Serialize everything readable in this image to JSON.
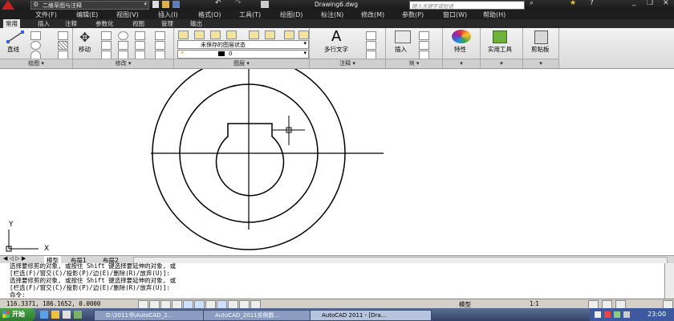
{
  "title_bar": {
    "workspace": "二维草图与注释",
    "document": "Drawing6.dwg",
    "search_placeholder": "键入关键字或短语"
  },
  "menu": [
    "文件(F)",
    "编辑(E)",
    "视图(V)",
    "插入(I)",
    "格式(O)",
    "工具(T)",
    "绘图(D)",
    "标注(N)",
    "修改(M)",
    "参数(P)",
    "窗口(W)",
    "帮助(H)"
  ],
  "tabs": [
    "常用",
    "插入",
    "注释",
    "参数化",
    "视图",
    "管理",
    "输出"
  ],
  "ribbon": {
    "line": "直线",
    "move": "移动",
    "layer_state": "未保存的图层状态",
    "layer_current": "0",
    "mtext": "多行文字",
    "insert": "插入",
    "properties": "特性",
    "utilities": "实用工具",
    "clipboard": "剪贴板",
    "panels": [
      "绘图",
      "修改",
      "图层",
      "注释",
      "块"
    ]
  },
  "layout_tabs": [
    "模型",
    "布局1",
    "布局2"
  ],
  "command_lines": [
    "选择要修剪的对象, 或按住 Shift 键选择要延伸的对象, 或",
    "[栏选(F)/窗交(C)/投影(P)/边(E)/删除(R)/放弃(U)]:",
    "选择要修剪的对象, 或按住 Shift 键选择要延伸的对象, 或",
    "[栏选(F)/窗交(C)/投影(P)/边(E)/删除(R)/放弃(U)]:",
    "命令:"
  ],
  "status": {
    "coords": "116.3371, 186.1652, 0.0000",
    "model": "模型",
    "scale": "1:1"
  },
  "taskbar": {
    "start": "开始",
    "tasks": [
      "D:\\2011书\\AutoCAD_2...",
      "AutoCAD_2011实例数...",
      "AutoCAD 2011 - [Dra..."
    ],
    "time": "23:00"
  },
  "ucs": {
    "x": "X",
    "y": "Y"
  },
  "colors": {
    "titlebar": "#1a1a1a",
    "taskbar": "#324266",
    "accent_red": "#c8201f"
  }
}
